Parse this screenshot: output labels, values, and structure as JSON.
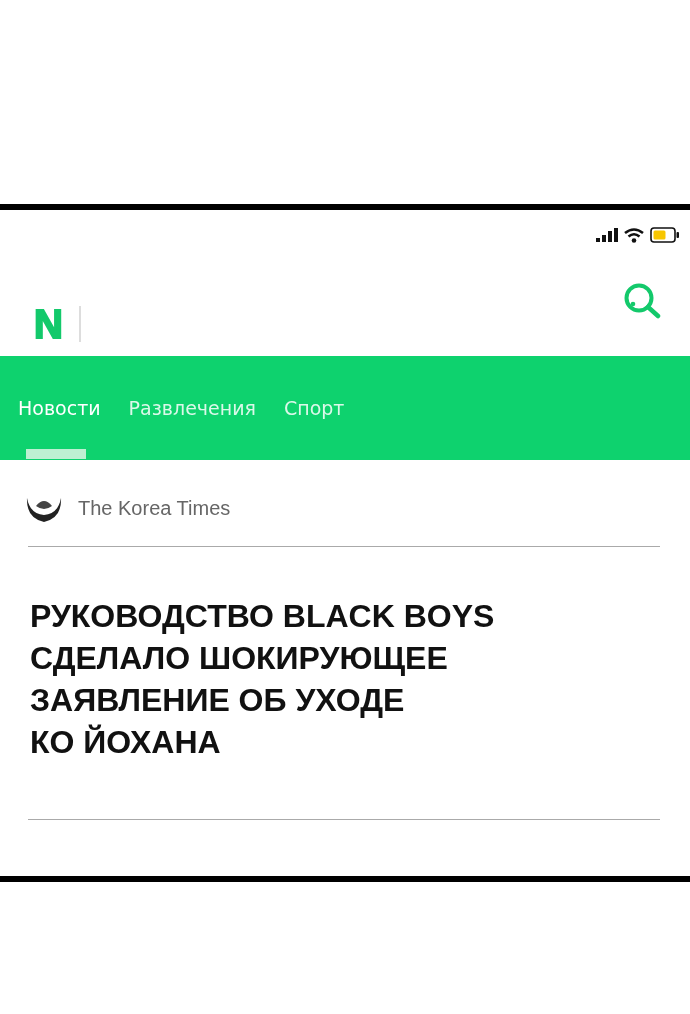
{
  "app": {
    "logo": "N"
  },
  "tabs": [
    {
      "label": "Новости",
      "selected": true
    },
    {
      "label": "Развлечения",
      "selected": false
    },
    {
      "label": "Спорт",
      "selected": false
    }
  ],
  "article": {
    "source": "The Korea Times",
    "headline": "РУКОВОДСТВО BLACK BOYS\nСДЕЛАЛО ШОКИРУЮЩЕЕ\nЗАЯВЛЕНИЕ ОБ УХОДЕ\nКО ЙОХАНА"
  }
}
